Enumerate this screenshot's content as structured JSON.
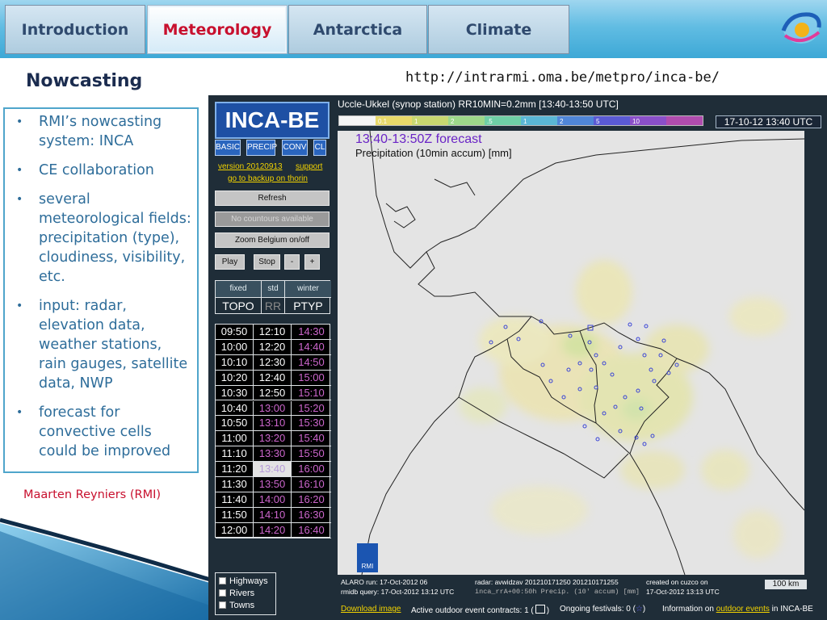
{
  "nav": {
    "tabs": [
      {
        "label": "Introduction"
      },
      {
        "label": "Meteorology"
      },
      {
        "label": "Antarctica"
      },
      {
        "label": "Climate"
      }
    ],
    "active_tab": "Meteorology"
  },
  "slide": {
    "heading": "Nowcasting",
    "url": "http://intrarmi.oma.be/metpro/inca-be/",
    "bullets": [
      "RMI’s nowcasting system: INCA",
      "CE collaboration",
      "several meteorological fields: precipitation (type), cloudiness, visibility, etc.",
      "input: radar, elevation data, weather stations, rain gauges, satellite data, NWP",
      "forecast for convective cells could be improved"
    ],
    "author": "Maarten Reyniers (RMI)"
  },
  "inca": {
    "brand": "INCA-BE",
    "categories": [
      "BASIC",
      "PRECIP",
      "CONV",
      "CL"
    ],
    "version": "version 20120913",
    "support": "support",
    "backup": "go to backup on thorin",
    "refresh": "Refresh",
    "no_contours": "No countours available",
    "zoom": "Zoom Belgium on/off",
    "play": "Play",
    "stop": "Stop",
    "minus": "-",
    "plus": "+",
    "modes": {
      "headers": [
        "fixed",
        "std",
        "winter"
      ],
      "values": [
        "TOPO",
        "RR",
        "PTYP"
      ]
    },
    "times": [
      [
        "09:50",
        "12:10",
        "14:30"
      ],
      [
        "10:00",
        "12:20",
        "14:40"
      ],
      [
        "10:10",
        "12:30",
        "14:50"
      ],
      [
        "10:20",
        "12:40",
        "15:00"
      ],
      [
        "10:30",
        "12:50",
        "15:10"
      ],
      [
        "10:40",
        "13:00",
        "15:20"
      ],
      [
        "10:50",
        "13:10",
        "15:30"
      ],
      [
        "11:00",
        "13:20",
        "15:40"
      ],
      [
        "11:10",
        "13:30",
        "15:50"
      ],
      [
        "11:20",
        "13:40",
        "16:00"
      ],
      [
        "11:30",
        "13:50",
        "16:10"
      ],
      [
        "11:40",
        "14:00",
        "16:20"
      ],
      [
        "11:50",
        "14:10",
        "16:30"
      ],
      [
        "12:00",
        "14:20",
        "16:40"
      ]
    ],
    "selected_time": "13:40",
    "layers": [
      "Highways",
      "Rivers",
      "Towns"
    ],
    "map_title": "Uccle-Ukkel (synop station) RR10MIN=0.2mm  [13:40-13:50 UTC]",
    "legend": [
      "",
      "0.1",
      "1",
      "2",
      ".5",
      "1",
      "2",
      "5",
      "10",
      ""
    ],
    "date_box": "17-10-12 13:40 UTC",
    "forecast_line": "13:40-13:50Z forecast",
    "forecast_field": "Precipitation (10min accum) [mm]",
    "rmi_logo": "RMI",
    "alaro_run": "ALARO run: 17-Oct-2012 06",
    "radar": "radar: avwidzav 201210171250 201210171255",
    "created": "created on cuzco on",
    "rmidb": "rmidb query: 17-Oct-2012 13:12 UTC",
    "file": "inca_rrA+00:50h Precip. (10' accum) [mm]",
    "created_time": "17-Oct-2012 13:13 UTC",
    "scale": "100 km",
    "download": "Download image",
    "contracts": "Active outdoor event contracts: 1 (",
    "contracts_end": ")",
    "festivals": "Ongoing festivals: 0 (",
    "festivals_end": ")",
    "info_prefix": "Information on",
    "info_link": "outdoor events",
    "info_suffix": "in INCA-BE"
  },
  "colors": {
    "accent_blue": "#4fa5cb",
    "author_red": "#c8102e",
    "forecast_purple": "#6a24c6",
    "yellow_link": "#f2d300"
  }
}
